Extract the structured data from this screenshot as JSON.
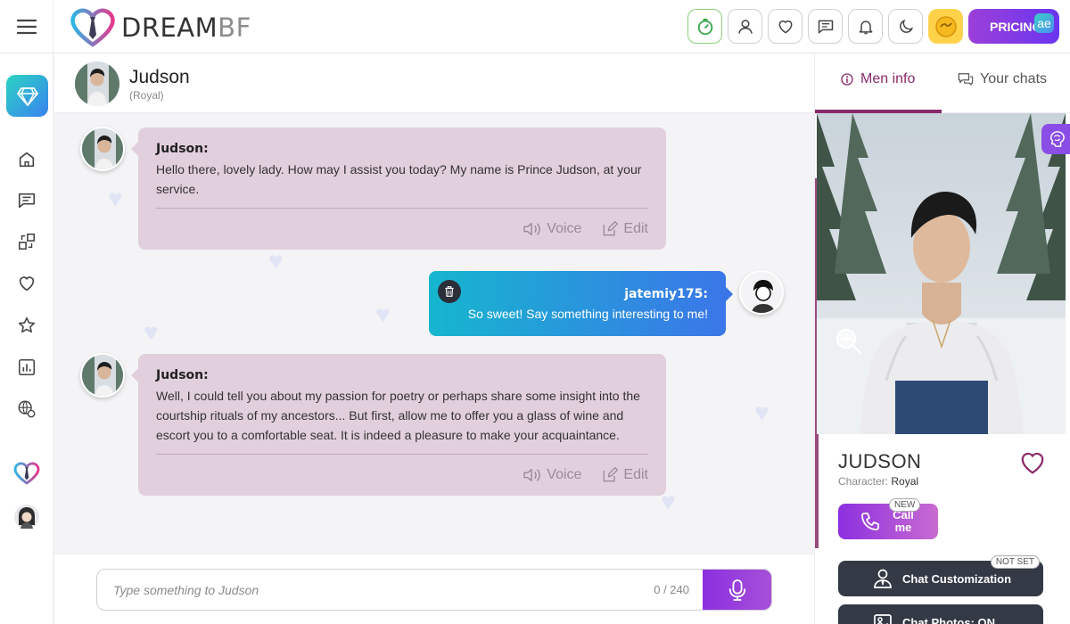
{
  "brand": {
    "name_main": "DREAM",
    "name_accent": "BF"
  },
  "topbar": {
    "pricing_label": "PRICING",
    "ae_badge": "ae",
    "icons": [
      "speed-icon",
      "profile-icon",
      "heart-icon",
      "messages-icon",
      "bell-icon",
      "dark-mode-icon",
      "coin-icon"
    ]
  },
  "sidebar": {
    "items": [
      "premium-diamond",
      "home",
      "chats",
      "swap",
      "favorites",
      "starred",
      "stats",
      "explore",
      "dreambf-heart",
      "user-avatar"
    ]
  },
  "chat": {
    "character_name": "Judson",
    "character_tier": "(Royal)",
    "messages": [
      {
        "role": "bot",
        "sender": "Judson:",
        "text": "Hello there, lovely lady. How may I assist you today? My name is Prince Judson, at your service.",
        "voice_label": "Voice",
        "edit_label": "Edit"
      },
      {
        "role": "user",
        "sender": "jatemiy175:",
        "text": "So sweet! Say something interesting to me!"
      },
      {
        "role": "bot",
        "sender": "Judson:",
        "text": "Well, I could tell you about my passion for poetry or perhaps share some insight into the courtship rituals of my ancestors... But first, allow me to offer you a glass of wine and escort you to a comfortable seat. It is indeed a pleasure to make your acquaintance.",
        "voice_label": "Voice",
        "edit_label": "Edit"
      }
    ]
  },
  "input": {
    "placeholder": "Type something to Judson",
    "char_count": "0 / 240"
  },
  "right_panel": {
    "tabs": [
      {
        "label": "Men info",
        "active": true
      },
      {
        "label": "Your chats",
        "active": false
      }
    ],
    "profile_name": "JUDSON",
    "character_label": "Character:",
    "character_value": "Royal",
    "call_label": "Call me",
    "call_badge": "NEW",
    "customization_label": "Chat Customization",
    "customization_badge": "NOT SET",
    "photos_label": "Chat Photos: ON"
  },
  "colors": {
    "accent_purple": "#8c2fe0",
    "brand_maroon": "#8a2a6a",
    "bot_bubble": "#e2cfdd",
    "user_bubble_start": "#16b6cf",
    "user_bubble_end": "#3b76e8",
    "dark_button": "#343a45"
  }
}
